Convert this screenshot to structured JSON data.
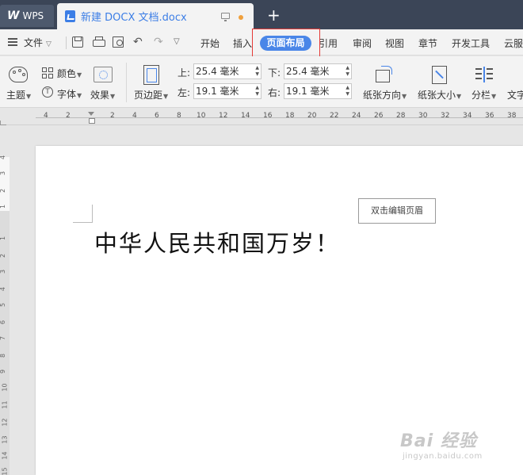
{
  "tabbar": {
    "wps_label": "WPS",
    "doc_title": "新建 DOCX 文档.docx",
    "new_tab": "+"
  },
  "menubar": {
    "file_label": "文件",
    "items": [
      "开始",
      "插入",
      "页面布局",
      "引用",
      "审阅",
      "视图",
      "章节",
      "开发工具",
      "云服"
    ],
    "active": "页面布局"
  },
  "ribbon": {
    "theme": "主题",
    "color": "颜色",
    "font": "字体",
    "effect": "效果",
    "margin": "页边距",
    "margins": {
      "top_label": "上:",
      "top_value": "25.4 毫米",
      "bottom_label": "下:",
      "bottom_value": "25.4 毫米",
      "left_label": "左:",
      "left_value": "19.1 毫米",
      "right_label": "右:",
      "right_value": "19.1 毫米"
    },
    "orientation": "纸张方向",
    "size": "纸张大小",
    "columns": "分栏",
    "text_dir": "文字"
  },
  "ruler": {
    "h_ticks": [
      "4",
      "2",
      "2",
      "4",
      "6",
      "8",
      "10",
      "12",
      "14",
      "16",
      "18",
      "20",
      "22",
      "24",
      "26",
      "28",
      "30",
      "32",
      "34",
      "36",
      "38"
    ],
    "v_ticks": [
      "4",
      "3",
      "2",
      "1",
      "1",
      "2",
      "3",
      "4",
      "5",
      "6",
      "7",
      "8",
      "9",
      "10",
      "11",
      "12",
      "13",
      "14",
      "15"
    ]
  },
  "document": {
    "header_button": "双击编辑页眉",
    "body_text": "中华人民共和国万岁！"
  },
  "watermark": {
    "main": "Bai 经验",
    "sub": "jingyan.baidu.com"
  }
}
